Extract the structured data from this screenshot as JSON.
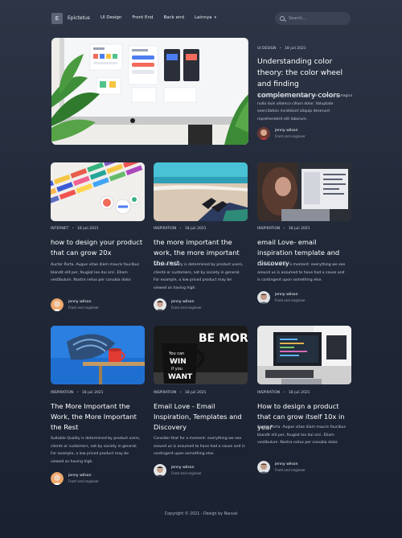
{
  "nav": {
    "logo_letter": "E",
    "brand": "Epictetus",
    "links": [
      "UI Design",
      "Front End",
      "Back end",
      "Lainnya"
    ],
    "search_placeholder": "Search..."
  },
  "featured": {
    "category": "UI DESIGN",
    "date": "18 juli 2021",
    "title": "Understanding color theory: the color wheel and finding complementary colors",
    "excerpt": "Nulla Lorem mollit cupidatat irure. Laborum magna nulla duis ullamco cillum dolor. Voluptate exercitation incididunt aliquip deserunt reprehenderit elit laborum.",
    "author": "jenny wilson",
    "role": "Front end engineer"
  },
  "cards": [
    {
      "category": "INTERNET",
      "date": "18 juli 2021",
      "title": "how to design your product that can grow 20x",
      "excerpt": "Auctor Porta. Augue vitae diam mauris faucibus blandit elit per, feugiat leo dui orci. Etiam vestibulum. Nostra netus per conubia dolor.",
      "author": "jenny wilson",
      "role": "Front end engineer"
    },
    {
      "category": "INSPIRATION",
      "date": "18 juli 2021",
      "title": "the more important the work, the more important the rest",
      "excerpt": "Suitable Quality is determined by product users, clients or customers, not by society in general. For example, a low priced product may be viewed as having high.",
      "author": "jenny wilson",
      "role": "Front end engineer"
    },
    {
      "category": "INSPIRATION",
      "date": "18 juli 2021",
      "title": "email Love- email inspiration template and discovery",
      "excerpt": "Consider that for a moment: everything we see around us is assumed to have had a cause and is contingent upon something else.",
      "author": "jenny wilson",
      "role": "Front end engineer"
    },
    {
      "category": "INSPIRATION",
      "date": "18 juli 2021",
      "title": "The More Important the Work, the More Important the Rest",
      "excerpt": "Suitable Quality is determined by product users, clients or customers, not by society in general. For example, a low priced product may be viewed as having high.",
      "author": "jenny wilson",
      "role": "Front end engineer"
    },
    {
      "category": "INSPIRATION",
      "date": "18 juli 2021",
      "title": "Email Love - Email Inspiration, Templates and Discovery",
      "excerpt": "Consider that for a moment: everything we see around us is assumed to have had a cause and is contingent upon something else.",
      "author": "jenny wilson",
      "role": "Front end engineer"
    },
    {
      "category": "INSPIRATION",
      "date": "18 juli 2021",
      "title": "How to design a product that can grow itself 10x in year",
      "excerpt": "Auctor Porta. Augue vitae diam mauris faucibus blandit elit per, feugiat leo dui orci. Etiam vestibulum. Nostra netus per conubia dolor.",
      "author": "jenny wilson",
      "role": "Front end engineer"
    }
  ],
  "mug_text": [
    "You can",
    "WIN",
    "if you",
    "WANT"
  ],
  "poster_text": "BE MORE",
  "footer": "Copyright © 2021 - Design by Nauval"
}
